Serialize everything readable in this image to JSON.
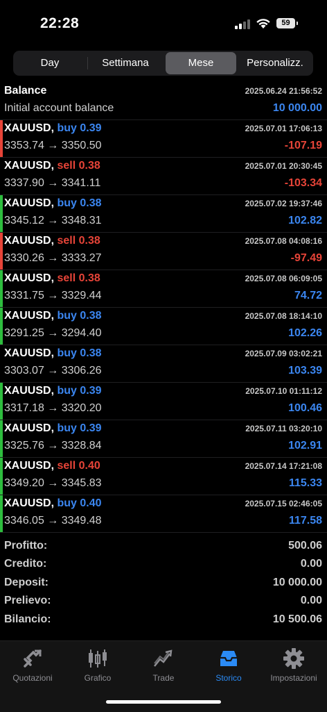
{
  "status": {
    "time": "22:28",
    "battery": "59"
  },
  "tabs_period": [
    "Day",
    "Settimana",
    "Mese",
    "Personalizz."
  ],
  "balance": {
    "title": "Balance",
    "date": "2025.06.24 21:56:52",
    "subtitle": "Initial account balance",
    "amount": "10 000.00"
  },
  "deals": [
    {
      "symbol": "XAUUSD,",
      "side": "buy",
      "vol": "0.39",
      "date": "2025.07.01 17:06:13",
      "prices": "3353.74 → 3350.50",
      "pnl": "-107.19",
      "bar": "red"
    },
    {
      "symbol": "XAUUSD,",
      "side": "sell",
      "vol": "0.38",
      "date": "2025.07.01 20:30:45",
      "prices": "3337.90 → 3341.11",
      "pnl": "-103.34",
      "bar": "none"
    },
    {
      "symbol": "XAUUSD,",
      "side": "buy",
      "vol": "0.38",
      "date": "2025.07.02 19:37:46",
      "prices": "3345.12 → 3348.31",
      "pnl": "102.82",
      "bar": "green"
    },
    {
      "symbol": "XAUUSD,",
      "side": "sell",
      "vol": "0.38",
      "date": "2025.07.08 04:08:16",
      "prices": "3330.26 → 3333.27",
      "pnl": "-97.49",
      "bar": "red"
    },
    {
      "symbol": "XAUUSD,",
      "side": "sell",
      "vol": "0.38",
      "date": "2025.07.08 06:09:05",
      "prices": "3331.75 → 3329.44",
      "pnl": "74.72",
      "bar": "green"
    },
    {
      "symbol": "XAUUSD,",
      "side": "buy",
      "vol": "0.38",
      "date": "2025.07.08 18:14:10",
      "prices": "3291.25 → 3294.40",
      "pnl": "102.26",
      "bar": "green"
    },
    {
      "symbol": "XAUUSD,",
      "side": "buy",
      "vol": "0.38",
      "date": "2025.07.09 03:02:21",
      "prices": "3303.07 → 3306.26",
      "pnl": "103.39",
      "bar": "none"
    },
    {
      "symbol": "XAUUSD,",
      "side": "buy",
      "vol": "0.39",
      "date": "2025.07.10 01:11:12",
      "prices": "3317.18 → 3320.20",
      "pnl": "100.46",
      "bar": "green"
    },
    {
      "symbol": "XAUUSD,",
      "side": "buy",
      "vol": "0.39",
      "date": "2025.07.11 03:20:10",
      "prices": "3325.76 → 3328.84",
      "pnl": "102.91",
      "bar": "green"
    },
    {
      "symbol": "XAUUSD,",
      "side": "sell",
      "vol": "0.40",
      "date": "2025.07.14 17:21:08",
      "prices": "3349.20 → 3345.83",
      "pnl": "115.33",
      "bar": "green"
    },
    {
      "symbol": "XAUUSD,",
      "side": "buy",
      "vol": "0.40",
      "date": "2025.07.15 02:46:05",
      "prices": "3346.05 → 3349.48",
      "pnl": "117.58",
      "bar": "green"
    }
  ],
  "summary": [
    {
      "label": "Profitto:",
      "value": "500.06"
    },
    {
      "label": "Credito:",
      "value": "0.00"
    },
    {
      "label": "Deposit:",
      "value": "10 000.00"
    },
    {
      "label": "Prelievo:",
      "value": "0.00"
    },
    {
      "label": "Bilancio:",
      "value": "10 500.06"
    }
  ],
  "tabbar": [
    {
      "label": "Quotazioni",
      "icon": "quotes-icon"
    },
    {
      "label": "Grafico",
      "icon": "chart-icon"
    },
    {
      "label": "Trade",
      "icon": "trade-icon"
    },
    {
      "label": "Storico",
      "icon": "history-icon",
      "active": true
    },
    {
      "label": "Impostazioni",
      "icon": "gear-icon"
    }
  ],
  "colors": {
    "buy": "#3b86f0",
    "sell": "#e74438",
    "bar_green": "#2ebd3e",
    "bar_red": "#e74438",
    "accent": "#2b8bf5"
  }
}
